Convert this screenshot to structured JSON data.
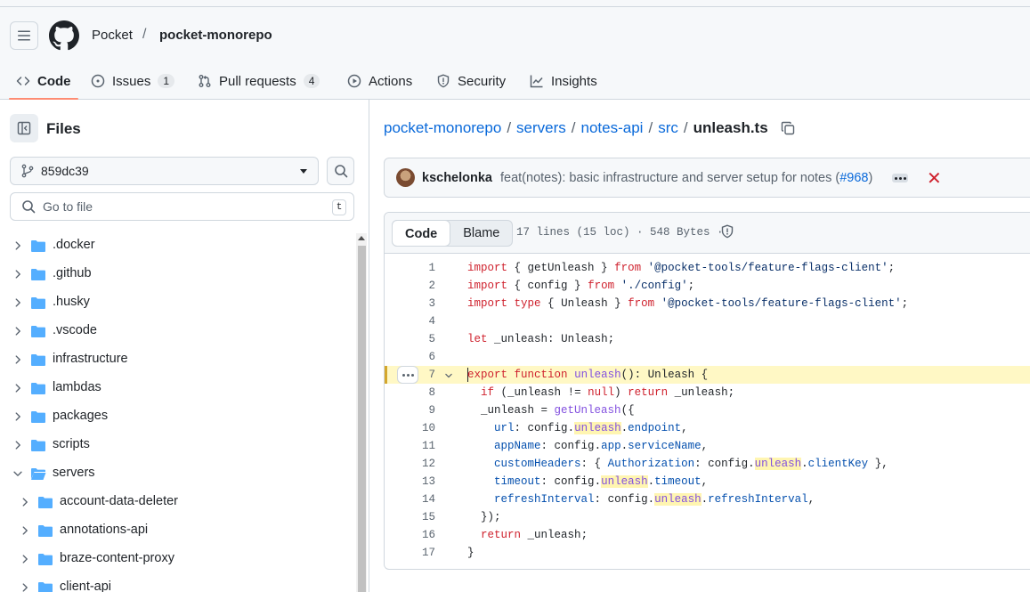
{
  "header": {
    "owner": "Pocket",
    "separator": "/",
    "repo": "pocket-monorepo"
  },
  "tabs": [
    {
      "label": "Code",
      "icon": "code-icon",
      "active": true
    },
    {
      "label": "Issues",
      "icon": "issue-icon",
      "count": "1"
    },
    {
      "label": "Pull requests",
      "icon": "pull-request-icon",
      "count": "4"
    },
    {
      "label": "Actions",
      "icon": "play-icon"
    },
    {
      "label": "Security",
      "icon": "shield-icon"
    },
    {
      "label": "Insights",
      "icon": "graph-icon"
    }
  ],
  "sidebar": {
    "title": "Files",
    "branch": "859dc39",
    "goto_placeholder": "Go to file",
    "goto_shortcut": "t",
    "tree": [
      {
        "label": ".docker",
        "expanded": false,
        "depth": 0
      },
      {
        "label": ".github",
        "expanded": false,
        "depth": 0
      },
      {
        "label": ".husky",
        "expanded": false,
        "depth": 0
      },
      {
        "label": ".vscode",
        "expanded": false,
        "depth": 0
      },
      {
        "label": "infrastructure",
        "expanded": false,
        "depth": 0
      },
      {
        "label": "lambdas",
        "expanded": false,
        "depth": 0
      },
      {
        "label": "packages",
        "expanded": false,
        "depth": 0
      },
      {
        "label": "scripts",
        "expanded": false,
        "depth": 0
      },
      {
        "label": "servers",
        "expanded": true,
        "depth": 0
      },
      {
        "label": "account-data-deleter",
        "expanded": false,
        "depth": 1
      },
      {
        "label": "annotations-api",
        "expanded": false,
        "depth": 1
      },
      {
        "label": "braze-content-proxy",
        "expanded": false,
        "depth": 1
      },
      {
        "label": "client-api",
        "expanded": false,
        "depth": 1
      }
    ]
  },
  "breadcrumb": {
    "parts": [
      "pocket-monorepo",
      "servers",
      "notes-api",
      "src"
    ],
    "separator": "/",
    "current": "unleash.ts"
  },
  "commit": {
    "author": "kschelonka",
    "message": "feat(notes): basic infrastructure and server setup for notes (",
    "pr": "#968",
    "message_end": ")",
    "status": "✕"
  },
  "code": {
    "view_code": "Code",
    "view_blame": "Blame",
    "info": "17 lines (15 loc) · 548 Bytes ·",
    "highlighted_line": 7,
    "lines": [
      "import { getUnleash } from '@pocket-tools/feature-flags-client';",
      "import { config } from './config';",
      "import type { Unleash } from '@pocket-tools/feature-flags-client';",
      "",
      "let _unleash: Unleash;",
      "",
      "export function unleash(): Unleash {",
      "  if (_unleash != null) return _unleash;",
      "  _unleash = getUnleash({",
      "    url: config.unleash.endpoint,",
      "    appName: config.app.serviceName,",
      "    customHeaders: { Authorization: config.unleash.clientKey },",
      "    timeout: config.unleash.timeout,",
      "    refreshInterval: config.unleash.refreshInterval,",
      "  });",
      "  return _unleash;",
      "}"
    ]
  },
  "colors": {
    "accent": "#0969da",
    "tab_underline": "#fd8c73",
    "folder": "#54aeff",
    "keyword": "#cf222e",
    "string": "#0a3069",
    "function": "#8250df",
    "property": "#0550ae",
    "highlight": "#fff8c5",
    "failure": "#cf222e"
  }
}
